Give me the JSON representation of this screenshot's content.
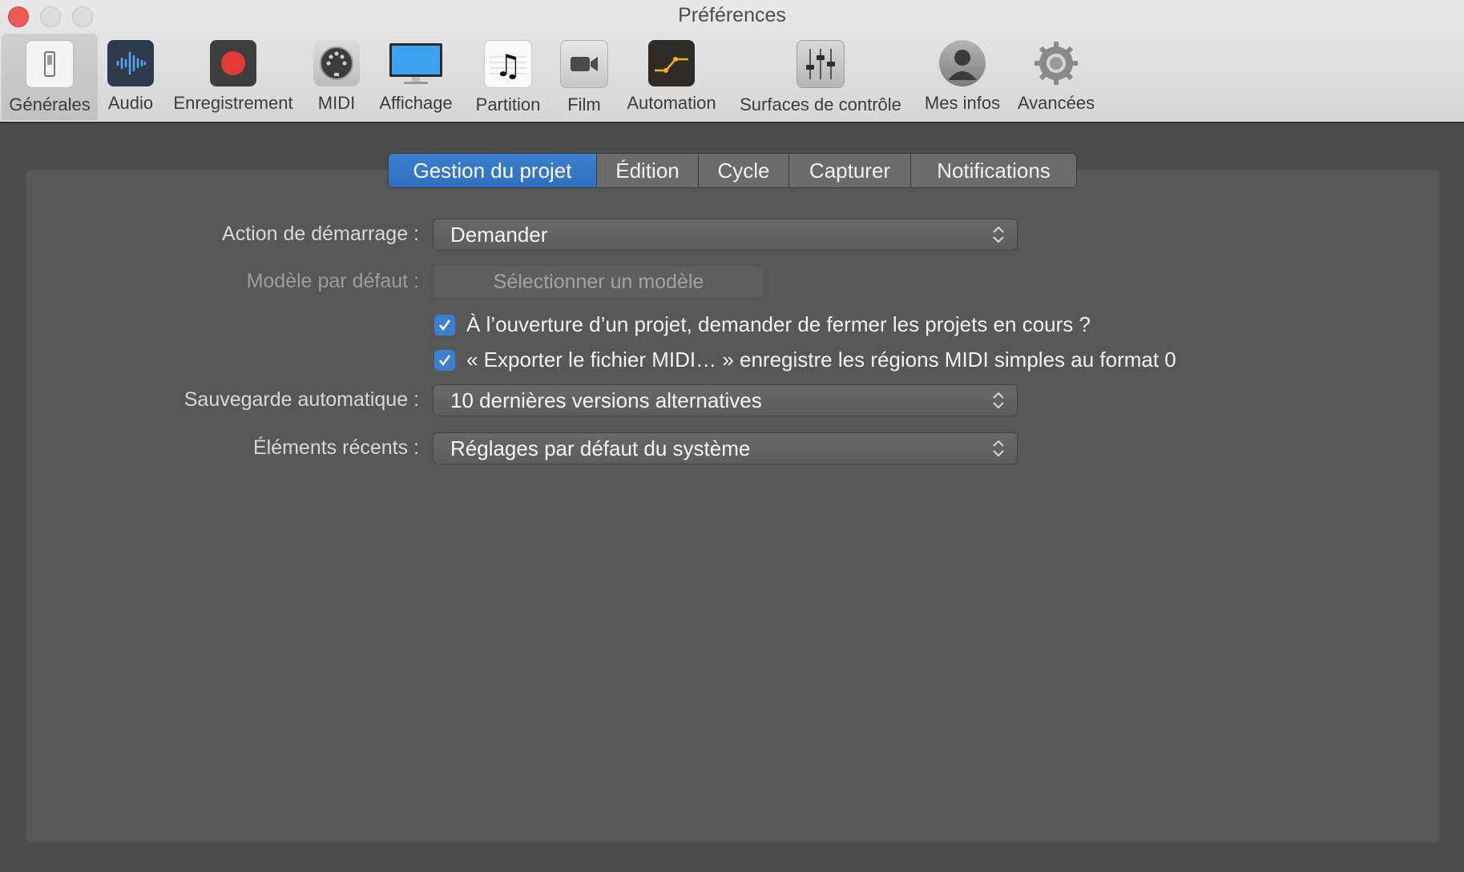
{
  "window": {
    "title": "Préférences"
  },
  "toolbar": {
    "items": [
      {
        "label": "Générales",
        "icon": "switch-icon",
        "selected": true
      },
      {
        "label": "Audio",
        "icon": "waveform-icon"
      },
      {
        "label": "Enregistrement",
        "icon": "record-icon"
      },
      {
        "label": "MIDI",
        "icon": "midi-connector-icon"
      },
      {
        "label": "Affichage",
        "icon": "display-icon"
      },
      {
        "label": "Partition",
        "icon": "music-note-icon"
      },
      {
        "label": "Film",
        "icon": "video-camera-icon"
      },
      {
        "label": "Automation",
        "icon": "automation-icon"
      },
      {
        "label": "Surfaces de contrôle",
        "icon": "faders-icon"
      },
      {
        "label": "Mes infos",
        "icon": "user-icon"
      },
      {
        "label": "Avancées",
        "icon": "gear-icon"
      }
    ]
  },
  "tabs": [
    {
      "label": "Gestion du projet",
      "active": true
    },
    {
      "label": "Édition"
    },
    {
      "label": "Cycle"
    },
    {
      "label": "Capturer"
    },
    {
      "label": "Notifications"
    }
  ],
  "form": {
    "startup_action": {
      "label": "Action de démarrage :",
      "value": "Demander"
    },
    "default_template": {
      "label": "Modèle par défaut :",
      "button": "Sélectionner un modèle"
    },
    "checkboxes": [
      {
        "label": "À l’ouverture d’un projet, demander de fermer les projets en cours ?",
        "checked": true
      },
      {
        "label": "« Exporter le fichier MIDI… » enregistre les régions MIDI simples au format 0",
        "checked": true
      }
    ],
    "autosave": {
      "label": "Sauvegarde automatique :",
      "value": "10 dernières versions alternatives"
    },
    "recent_items": {
      "label": "Éléments récents :",
      "value": "Réglages par défaut du système"
    }
  },
  "colors": {
    "accent": "#3b7fd0",
    "close": "#ee5b56",
    "panel": "#575757",
    "automation_line": "#f2b01e"
  }
}
